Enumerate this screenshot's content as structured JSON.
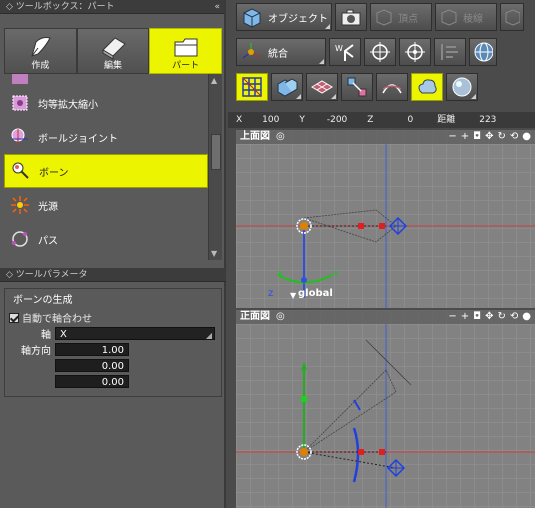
{
  "left": {
    "toolbox_header": "◇ ツールボックス：パート",
    "collapse_glyph": "«",
    "tabs": [
      {
        "label": "作成"
      },
      {
        "label": "編集"
      },
      {
        "label": "パート"
      }
    ],
    "items": [
      {
        "label": "均等拡大縮小"
      },
      {
        "label": "ボールジョイント"
      },
      {
        "label": "ボーン"
      },
      {
        "label": "光源"
      },
      {
        "label": "パス"
      }
    ],
    "params_header": "◇ ツールパラメータ",
    "group_title": "ボーンの生成",
    "auto_align_label": "自動で軸合わせ",
    "axis_label": "軸",
    "axis_value": "X",
    "direction_label": "軸方向",
    "direction_values": [
      "1.00",
      "0.00",
      "0.00"
    ]
  },
  "toolbar": {
    "object_label": "オブジェクト",
    "vertex_label": "頂点",
    "edge_label": "稜線",
    "combine_label": "統合"
  },
  "coords": {
    "x_label": "X",
    "x_value": "100",
    "y_label": "Y",
    "y_value": "-200",
    "z_label": "Z",
    "z_value": "0",
    "dist_label": "距離",
    "dist_value": "223"
  },
  "views": {
    "top_title": "上面図",
    "front_title": "正面図",
    "global_label": "global",
    "z_axis_label": "z"
  },
  "colors": {
    "accent_yellow": "#ecf400",
    "grid_bg": "#828282",
    "panel_bg": "#5a5a5a"
  }
}
